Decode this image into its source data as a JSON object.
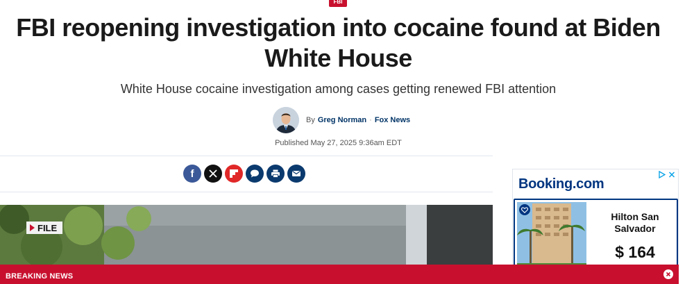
{
  "article": {
    "category": "FBI",
    "headline": "FBI reopening investigation into cocaine found at Biden White House",
    "subheadline": "White House cocaine investigation among cases getting renewed FBI attention",
    "byline_prefix": "By",
    "author": "Greg Norman",
    "separator": "·",
    "source": "Fox News",
    "published": "Published May 27, 2025 9:36am EDT"
  },
  "share": {
    "buttons": [
      {
        "name": "facebook-icon",
        "glyph": "f",
        "color": "#3b5998"
      },
      {
        "name": "x-icon",
        "glyph": "𝕏",
        "color": "#111111"
      },
      {
        "name": "flipboard-icon",
        "glyph": "f",
        "color": "#e12828"
      },
      {
        "name": "comments-icon",
        "glyph": "",
        "color": "#0b3a6e"
      },
      {
        "name": "print-icon",
        "glyph": "",
        "color": "#0b3a6e"
      },
      {
        "name": "email-icon",
        "glyph": "",
        "color": "#0b3a6e"
      }
    ]
  },
  "hero": {
    "tag": "FILE"
  },
  "ad": {
    "brand_main": "Booking",
    "brand_tld": ".com",
    "hotel_name": "Hilton San Salvador",
    "price": "$ 164",
    "brand_color": "#003580"
  },
  "breaking": {
    "label": "BREAKING NEWS",
    "color": "#c8102e"
  }
}
